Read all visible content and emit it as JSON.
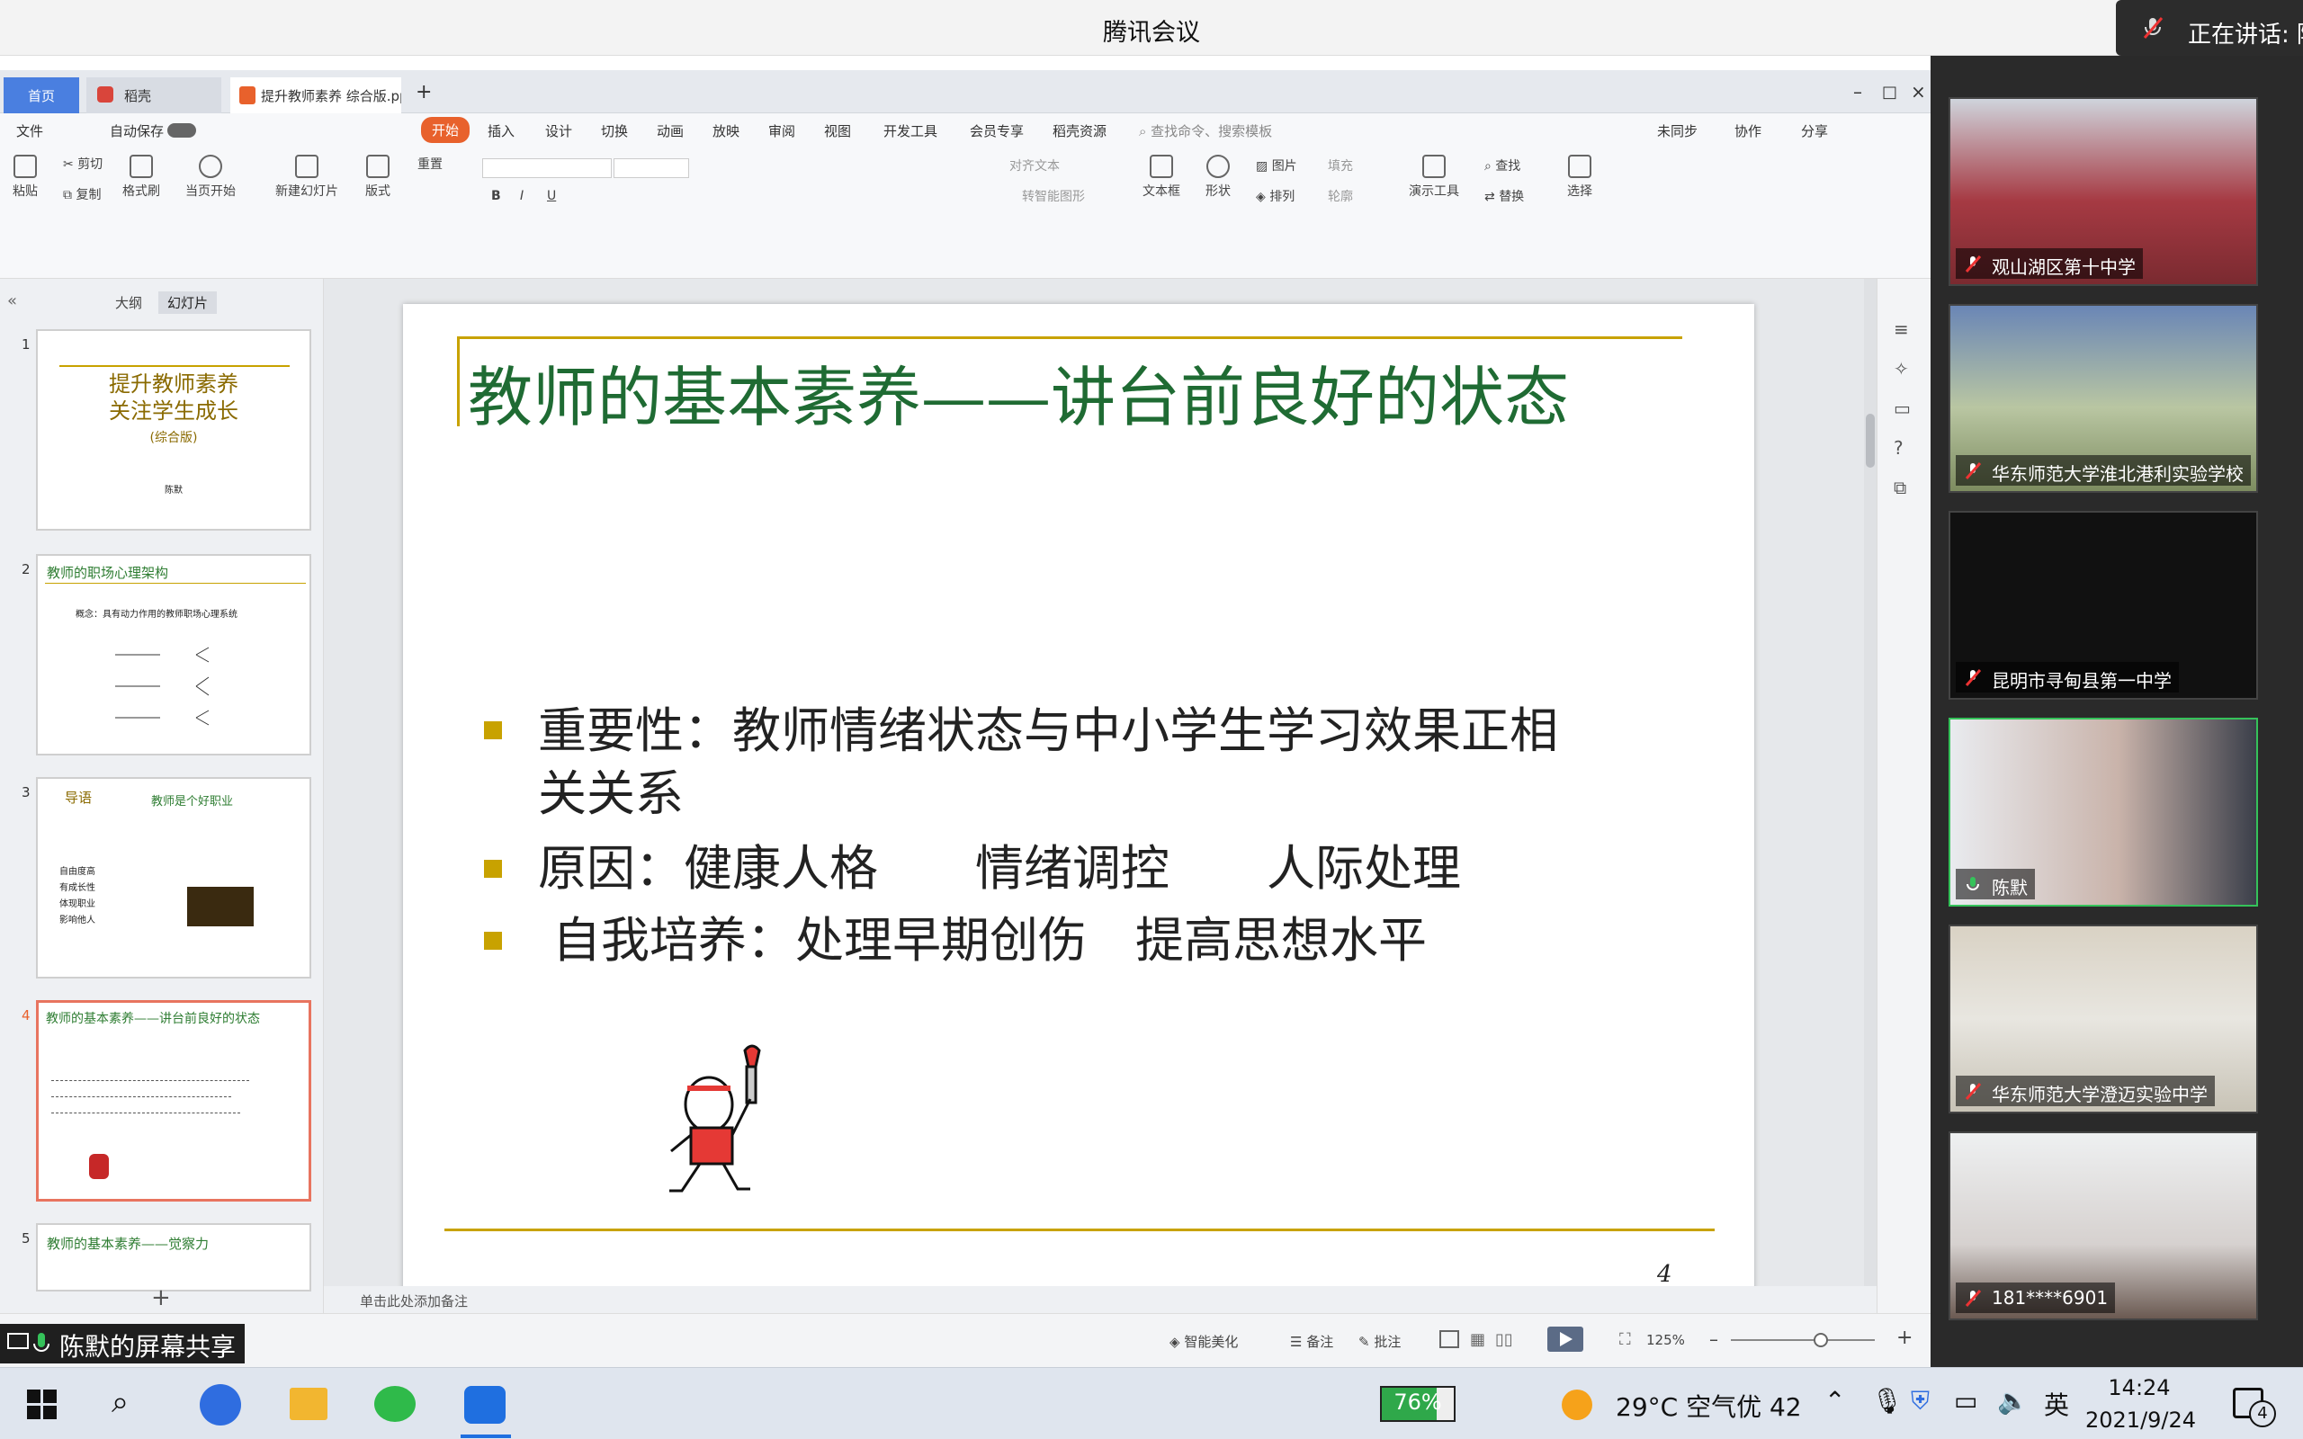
{
  "app": {
    "title": "腾讯会议",
    "speaking": "正在讲话: 陈"
  },
  "wps": {
    "tabs": [
      "首页",
      "稻壳",
      "提升教师素养 综合版.pp"
    ],
    "menu": [
      "文件",
      "自动保存",
      "开始",
      "插入",
      "设计",
      "切换",
      "动画",
      "放映",
      "审阅",
      "视图",
      "开发工具",
      "会员专享",
      "稻壳资源",
      "查找命令、搜索模板",
      "未同步",
      "协作",
      "分享"
    ],
    "ribbon": {
      "paste": "粘贴",
      "cut": "剪切",
      "copy": "复制",
      "format_painter": "格式刷",
      "play": "当页开始",
      "new_slide": "新建幻灯片",
      "layout": "版式",
      "reset": "重置",
      "align_text": "对齐文本",
      "smart_shape": "转智能图形",
      "textbox": "文本框",
      "shape": "形状",
      "picture": "图片",
      "arrange": "排列",
      "fill": "填充",
      "outline": "轮廓",
      "present_tools": "演示工具",
      "find": "查找",
      "replace": "替换",
      "select": "选择"
    },
    "panel_tabs": [
      "大纲",
      "幻灯片"
    ],
    "thumbs": [
      {
        "num": "1",
        "title": "提升教师素养\n关注学生成长",
        "sub": "(综合版)",
        "author": "陈默"
      },
      {
        "num": "2",
        "title": "教师的职场心理架构",
        "sub": "概念：具有动力作用的教师职场心理系统"
      },
      {
        "num": "3",
        "title": "导语",
        "sub": "教师是个好职业",
        "items": [
          "自由度高",
          "有成长性",
          "体现职业",
          "影响他人"
        ]
      },
      {
        "num": "4",
        "title": "教师的基本素养——讲台前良好的状态"
      },
      {
        "num": "5",
        "title": "教师的基本素养——觉察力"
      }
    ],
    "slide": {
      "title": "教师的基本素养——讲台前良好的状态",
      "bullets": [
        "重要性：教师情绪状态与中小学生学习效果正相\n关关系",
        "原因：健康人格　　情绪调控　　人际处理",
        "自我培养：处理早期创伤　提高思想水平"
      ],
      "page": "4"
    },
    "notes_placeholder": "单击此处添加备注",
    "status": {
      "beautify": "智能美化",
      "notes": "备注",
      "comment": "批注",
      "zoom": "125%"
    }
  },
  "share_label": "陈默的屏幕共享",
  "participants": [
    {
      "name": "观山湖区第十中学",
      "muted": true
    },
    {
      "name": "华东师范大学淮北港利实验学校",
      "muted": true
    },
    {
      "name": "昆明市寻甸县第一中学",
      "muted": true
    },
    {
      "name": "陈默",
      "muted": false
    },
    {
      "name": "华东师范大学澄迈实验中学",
      "muted": true
    },
    {
      "name": "181****6901",
      "muted": true
    }
  ],
  "taskbar": {
    "battery": "76%",
    "weather": "29°C 空气优 42",
    "ime": "英",
    "time": "14:24",
    "date": "2021/9/24",
    "notifications": "4"
  }
}
